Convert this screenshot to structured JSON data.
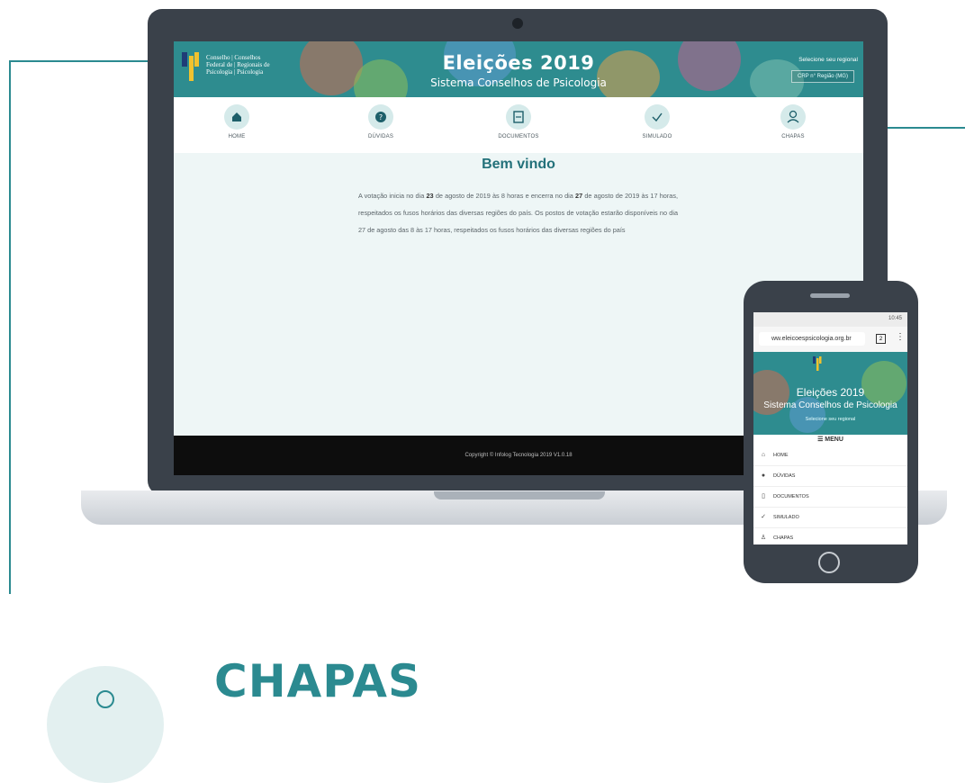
{
  "colors": {
    "accent": "#2b8a90",
    "laptop_frame": "#3a414a",
    "screen_bg": "#eef6f6",
    "banner": "#2e8c8f"
  },
  "site": {
    "logo_lines": [
      "Conselho | Conselhos",
      "Federal de | Regionais de",
      "Psicologia | Psicologia"
    ],
    "title": "Eleições 2019",
    "subtitle": "Sistema Conselhos de Psicologia",
    "regional_label": "Selecione seu regional",
    "regional_value": "CRP n° Região (MG)"
  },
  "nav": [
    {
      "label": "HOME",
      "icon": "home-icon"
    },
    {
      "label": "DÚVIDAS",
      "icon": "question-icon"
    },
    {
      "label": "DOCUMENTOS",
      "icon": "document-icon"
    },
    {
      "label": "SIMULADO",
      "icon": "check-icon"
    },
    {
      "label": "CHAPAS",
      "icon": "user-icon"
    }
  ],
  "welcome": {
    "heading": "Bem vindo",
    "p1": "A votação inicia no dia ",
    "d1": "23",
    "p2": " de agosto de 2019 às 8 horas e encerra no dia ",
    "d2": "27",
    "p3": " de agosto de 2019 às 17 horas, respeitados os fusos horários das diversas regiões do país. Os postos de votação estarão disponíveis no dia 27 de agosto das 8 às 17 horas, respeitados os fusos horários das diversas regiões do país"
  },
  "footer": {
    "copyright": "Copyright © Infolog Tecnologia 2019 V1.0.18"
  },
  "phone": {
    "status_time": "10:45",
    "url": "ww.eleicoespsicologia.org.br",
    "tab_count": "2",
    "title": "Eleições 2019",
    "subtitle": "Sistema Conselhos de Psicologia",
    "regional_label": "Selecione seu regional",
    "menu_label": "☰ MENU",
    "menu_items": [
      {
        "label": "HOME",
        "icon": "home-icon"
      },
      {
        "label": "DÚVIDAS",
        "icon": "question-icon"
      },
      {
        "label": "DOCUMENTOS",
        "icon": "document-icon"
      },
      {
        "label": "SIMULADO",
        "icon": "check-icon"
      },
      {
        "label": "CHAPAS",
        "icon": "user-icon"
      }
    ]
  },
  "section": {
    "title": "CHAPAS"
  }
}
